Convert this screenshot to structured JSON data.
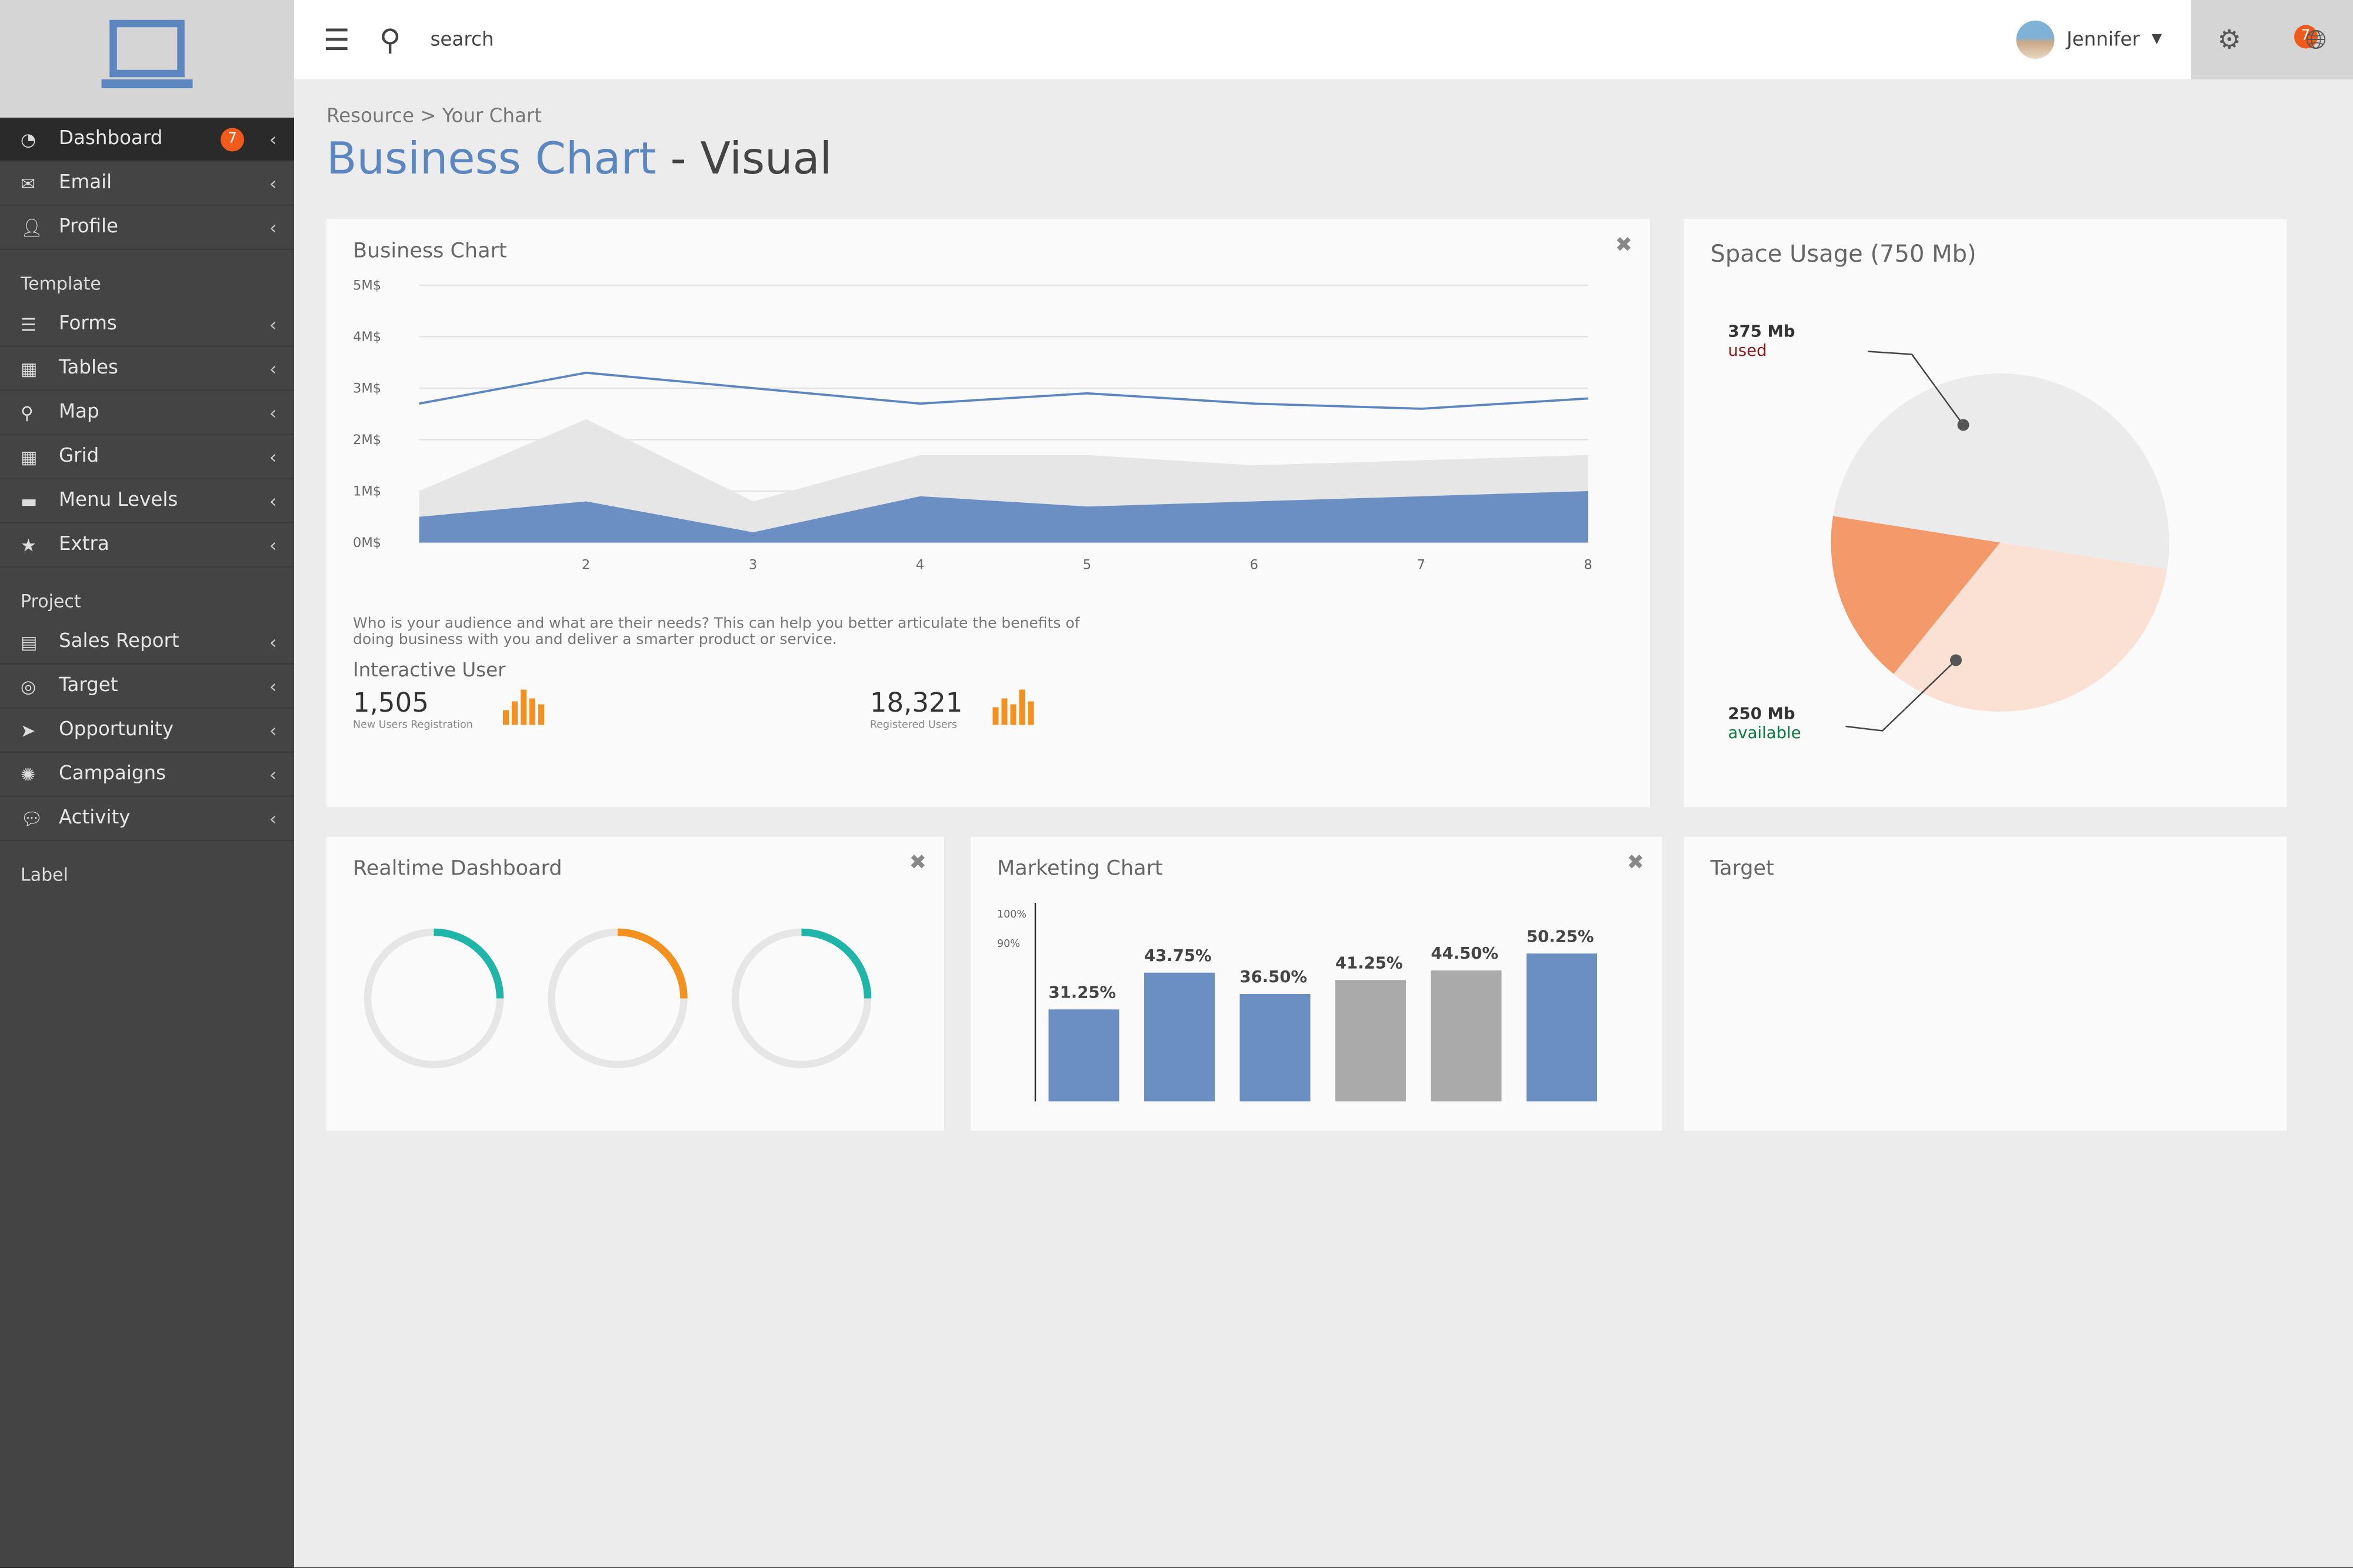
{
  "sidebar": {
    "items": [
      {
        "label": "Dashboard",
        "icon": "pie-chart-icon",
        "badge": "7"
      },
      {
        "label": "Email",
        "icon": "envelope-icon"
      },
      {
        "label": "Profile",
        "icon": "user-icon"
      }
    ],
    "sections": [
      {
        "title": "Template",
        "items": [
          {
            "label": "Forms",
            "icon": "lines-icon"
          },
          {
            "label": "Tables",
            "icon": "table-icon"
          },
          {
            "label": "Map",
            "icon": "map-pin-icon"
          },
          {
            "label": "Grid",
            "icon": "grid-icon"
          },
          {
            "label": "Menu Levels",
            "icon": "folder-icon"
          },
          {
            "label": "Extra",
            "icon": "star-icon"
          }
        ]
      },
      {
        "title": "Project",
        "items": [
          {
            "label": "Sales Report",
            "icon": "report-icon"
          },
          {
            "label": "Target",
            "icon": "target-icon"
          },
          {
            "label": "Opportunity",
            "icon": "rocket-icon"
          },
          {
            "label": "Campaigns",
            "icon": "badge-icon"
          },
          {
            "label": "Activity",
            "icon": "chat-icon"
          }
        ]
      },
      {
        "title": "Label",
        "items": []
      }
    ]
  },
  "topbar": {
    "search_placeholder": "search",
    "user": "Jennifer",
    "notifications": "7"
  },
  "breadcrumb": "Resource > Your Chart",
  "title": {
    "main": "Business Chart",
    "suffix": "- Visual"
  },
  "business_card": {
    "title": "Business Chart",
    "description": "Who is your audience and what are their needs? This can help you better articulate the benefits of doing business with you and deliver a smarter product or service.",
    "interactive_title": "Interactive User",
    "new_users": "1,505",
    "new_users_label": "New Users Registration",
    "registered": "18,321",
    "registered_label": "Registered Users"
  },
  "space_card": {
    "title": "Space Usage (750 Mb)",
    "used_value": "375 Mb",
    "used_label": "used",
    "available_value": "250 Mb",
    "available_label": "available"
  },
  "realtime_card": {
    "title": "Realtime Dashboard"
  },
  "marketing_card": {
    "title": "Marketing Chart"
  },
  "target_card": {
    "title": "Target"
  },
  "colors": {
    "accent": "#5b86c0",
    "orange": "#f4901e",
    "badge": "#f05a1a",
    "teal": "#1fb5a8"
  },
  "chart_data": [
    {
      "type": "area",
      "title": "Business Chart",
      "x": [
        1,
        2,
        3,
        4,
        5,
        6,
        7,
        8
      ],
      "xticks": [
        "2",
        "3",
        "4",
        "5",
        "6",
        "7",
        "8"
      ],
      "yticks": [
        "0M$",
        "1M$",
        "2M$",
        "3M$",
        "4M$",
        "5M$"
      ],
      "ylim": [
        0,
        5
      ],
      "series": [
        {
          "kind": "line",
          "color": "#5b86c0",
          "values": [
            2.7,
            3.3,
            3.0,
            2.7,
            2.9,
            2.7,
            2.6,
            2.8
          ]
        },
        {
          "kind": "area",
          "color": "#e6e6e6",
          "values": [
            1.0,
            2.4,
            0.8,
            1.7,
            1.7,
            1.5,
            1.6,
            1.7
          ]
        },
        {
          "kind": "area",
          "color": "#6b8fc2",
          "values": [
            0.5,
            0.8,
            0.2,
            0.9,
            0.7,
            0.8,
            0.9,
            1.0
          ]
        }
      ]
    },
    {
      "type": "pie",
      "title": "Space Usage (750 Mb)",
      "slices": [
        {
          "label": "used",
          "value": 375,
          "color": "#ebebeb"
        },
        {
          "label": "available",
          "value": 250,
          "color": "#fbe0d4"
        },
        {
          "value": 125,
          "color": "#f4996a"
        }
      ]
    },
    {
      "type": "bar",
      "title": "Marketing Chart",
      "yticks": [
        "90%",
        "100%"
      ],
      "labels": [
        "31.25%",
        "43.75%",
        "36.50%",
        "41.25%",
        "44.50%",
        "50.25%"
      ],
      "values": [
        31.25,
        43.75,
        36.5,
        41.25,
        44.5,
        50.25
      ],
      "colors": [
        "#6b8fc2",
        "#6b8fc2",
        "#6b8fc2",
        "#aaaaaa",
        "#aaaaaa",
        "#6b8fc2"
      ]
    },
    {
      "type": "gauge",
      "title": "Realtime Dashboard",
      "colors": [
        "#1fb5a8",
        "#f4901e",
        "#1fb5a8"
      ]
    }
  ]
}
